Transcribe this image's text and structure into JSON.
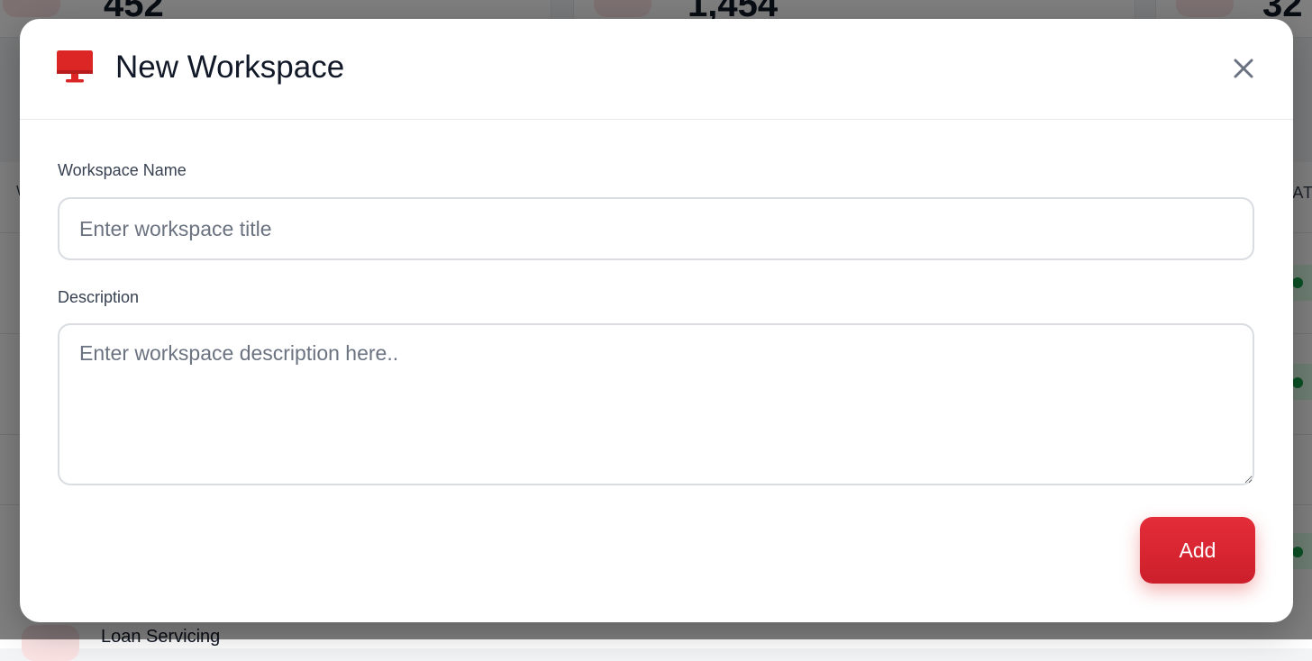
{
  "background": {
    "stats": [
      {
        "value": "452"
      },
      {
        "value": "1,454"
      },
      {
        "value": "32"
      }
    ],
    "table_header_left": "W",
    "table_header_right": "TAT",
    "row_label": "Loan Servicing"
  },
  "modal": {
    "title": "New Workspace",
    "icon": "monitor-icon",
    "close_icon": "close-icon",
    "accent_color": "#dc2626",
    "workspace_name": {
      "label": "Workspace Name",
      "placeholder": "Enter workspace title",
      "value": ""
    },
    "description": {
      "label": "Description",
      "placeholder": "Enter workspace description here..",
      "value": ""
    },
    "add_button_label": "Add"
  }
}
